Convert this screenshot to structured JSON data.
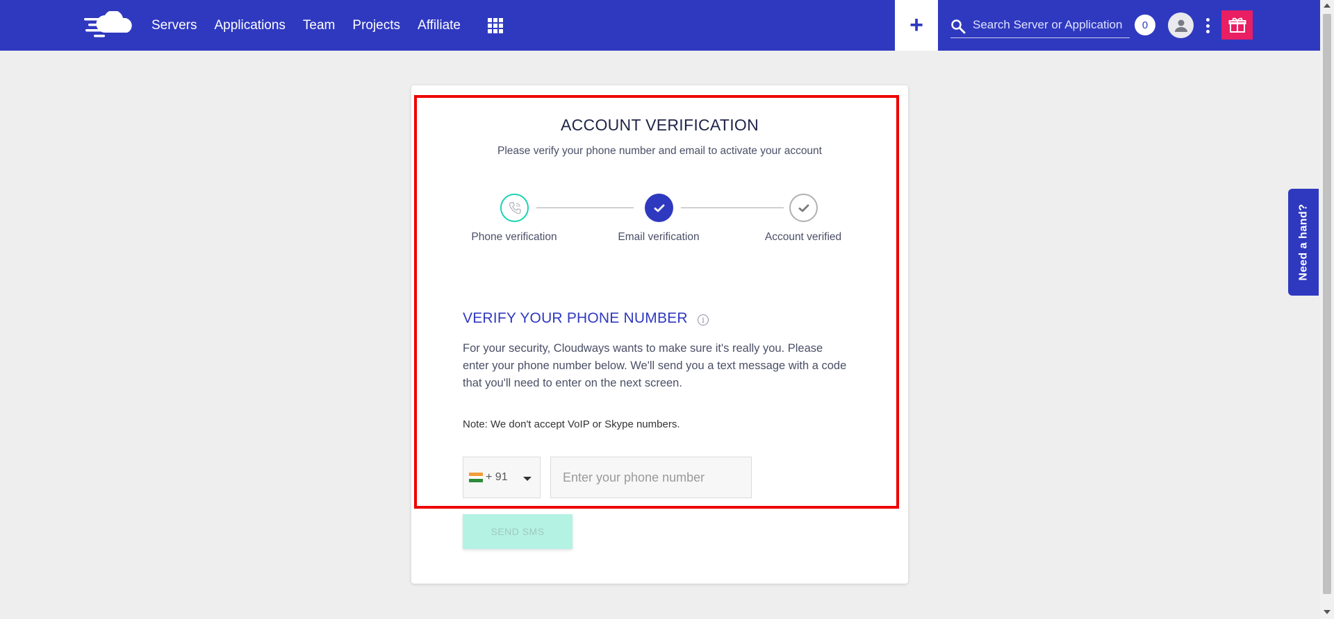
{
  "header": {
    "nav": [
      "Servers",
      "Applications",
      "Team",
      "Projects",
      "Affiliate"
    ],
    "add_label": "+",
    "search_placeholder": "Search Server or Application",
    "notification_count": "0"
  },
  "card": {
    "title": "ACCOUNT VERIFICATION",
    "subtitle": "Please verify your phone number and email to activate your account",
    "steps": [
      {
        "label": "Phone verification",
        "status": "current"
      },
      {
        "label": "Email verification",
        "status": "done"
      },
      {
        "label": "Account verified",
        "status": "pending"
      }
    ],
    "section_title": "VERIFY YOUR PHONE NUMBER",
    "section_body": "For your security, Cloudways wants to make sure it's really you. Please enter your phone number below. We'll send you a text message with a code that you'll need to enter on the next screen.",
    "note": "Note: We don't accept VoIP or Skype numbers.",
    "country_code": "+ 91",
    "phone_placeholder": "Enter your phone number",
    "send_label": "SEND SMS"
  },
  "side_tab": "Need a hand?",
  "colors": {
    "brand": "#2f39bf",
    "accent_teal": "#1ad3b0",
    "gift": "#e91e63",
    "highlight": "#ee0000"
  }
}
